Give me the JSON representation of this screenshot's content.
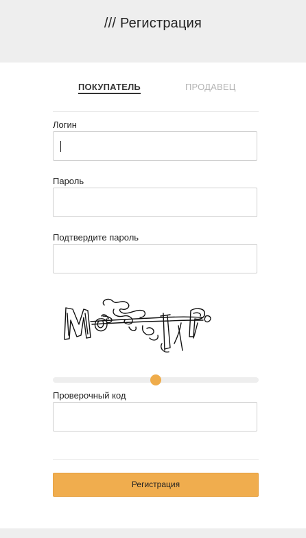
{
  "header": {
    "title": "/// Регистрация"
  },
  "tabs": {
    "buyer": "ПОКУПАТЕЛЬ",
    "seller": "ПРОДАВЕЦ",
    "active": "buyer"
  },
  "form": {
    "login": {
      "label": "Логин",
      "value": ""
    },
    "password": {
      "label": "Пароль",
      "value": ""
    },
    "confirm_password": {
      "label": "Подтвердите пароль",
      "value": ""
    },
    "captcha_slider": {
      "level": 0.5
    },
    "verification_code": {
      "label": "Проверочный код",
      "value": ""
    },
    "submit_label": "Регистрация"
  },
  "colors": {
    "accent": "#f0ad4e",
    "header_bg": "#eeeeee",
    "tab_inactive": "#b5b5b5"
  }
}
